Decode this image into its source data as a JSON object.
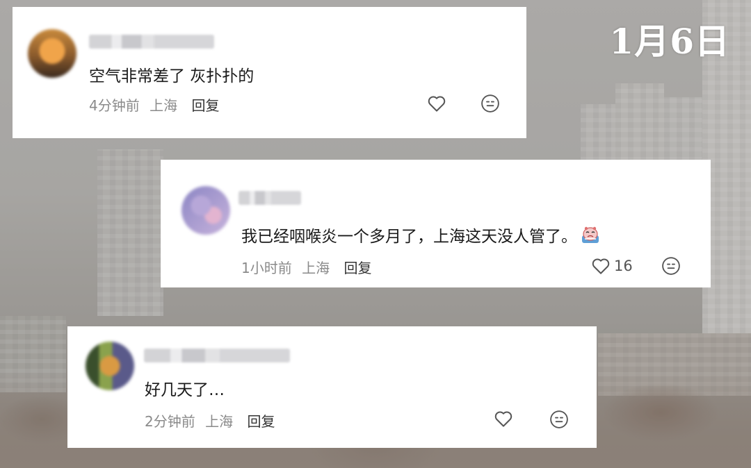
{
  "date_stamp": "1月6日",
  "comments": [
    {
      "content": "空气非常差了 灰扑扑的",
      "time": "4分钟前",
      "location": "上海",
      "reply_label": "回复",
      "like_count": ""
    },
    {
      "content": "我已经咽喉炎一个多月了，上海这天没人管了。",
      "time": "1小时前",
      "location": "上海",
      "reply_label": "回复",
      "like_count": "16",
      "inline_emoji": "crying-face-emoji"
    },
    {
      "content": "好几天了…",
      "time": "2分钟前",
      "location": "上海",
      "reply_label": "回复",
      "like_count": ""
    }
  ],
  "icons": {
    "like": "heart-outline-icon",
    "react": "emoji-smile-icon"
  },
  "colors": {
    "card_bg": "#ffffff",
    "meta_text": "#8a8a8a",
    "content_text": "#1a1a1a"
  }
}
